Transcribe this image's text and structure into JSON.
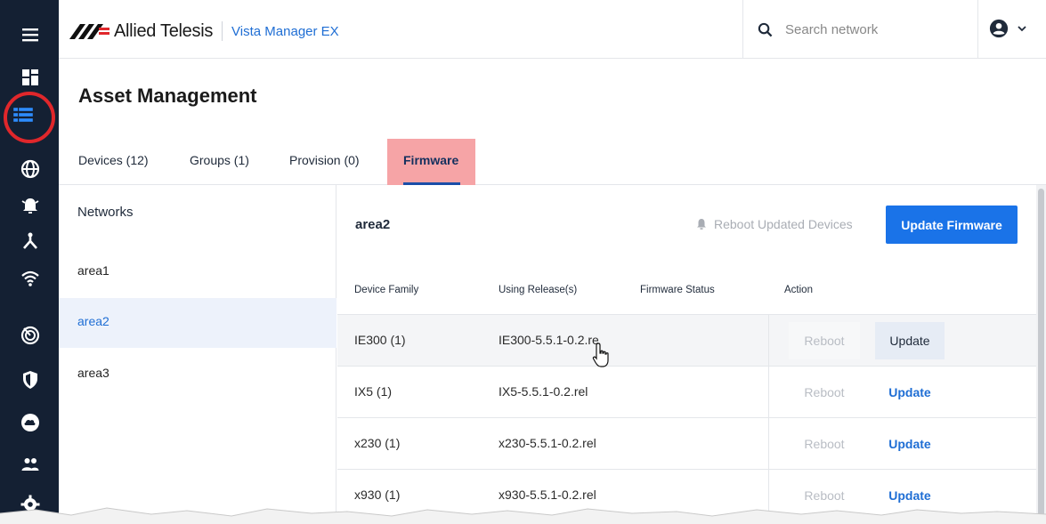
{
  "app": {
    "brand": "Allied Telesis",
    "product": "Vista Manager EX"
  },
  "search": {
    "placeholder": "Search network"
  },
  "page": {
    "title": "Asset Management"
  },
  "tabs": [
    {
      "label": "Devices (12)"
    },
    {
      "label": "Groups (1)"
    },
    {
      "label": "Provision (0)"
    },
    {
      "label": "Firmware",
      "active": true
    }
  ],
  "networks": {
    "title": "Networks",
    "items": [
      {
        "label": "area1"
      },
      {
        "label": "area2",
        "selected": true
      },
      {
        "label": "area3"
      }
    ]
  },
  "detail": {
    "area_title": "area2",
    "reboot_all_label": "Reboot Updated Devices",
    "update_firmware_label": "Update Firmware",
    "columns": [
      "Device Family",
      "Using Release(s)",
      "Firmware Status",
      "Action"
    ],
    "rows": [
      {
        "family": "IE300 (1)",
        "release": "IE300-5.5.1-0.2.re",
        "status": "",
        "reboot": "Reboot",
        "update": "Update"
      },
      {
        "family": "IX5 (1)",
        "release": "IX5-5.5.1-0.2.rel",
        "status": "",
        "reboot": "Reboot",
        "update": "Update"
      },
      {
        "family": "x230 (1)",
        "release": "x230-5.5.1-0.2.rel",
        "status": "",
        "reboot": "Reboot",
        "update": "Update"
      },
      {
        "family": "x930 (1)",
        "release": "x930-5.5.1-0.2.rel",
        "status": "",
        "reboot": "Reboot",
        "update": "Update"
      }
    ]
  },
  "colors": {
    "rail": "#142033",
    "accent": "#1a73e8",
    "link": "#1f6ed4",
    "highlight_annotation": "#f6a4a6",
    "annotation_ring": "#e0272b"
  },
  "rail_icons": [
    "menu-icon",
    "dashboard-icon",
    "asset-list-icon",
    "globe-icon",
    "alarm-icon",
    "topology-icon",
    "wifi-icon",
    "sla-icon",
    "security-icon",
    "cloud-icon",
    "users-icon",
    "settings-icon"
  ]
}
